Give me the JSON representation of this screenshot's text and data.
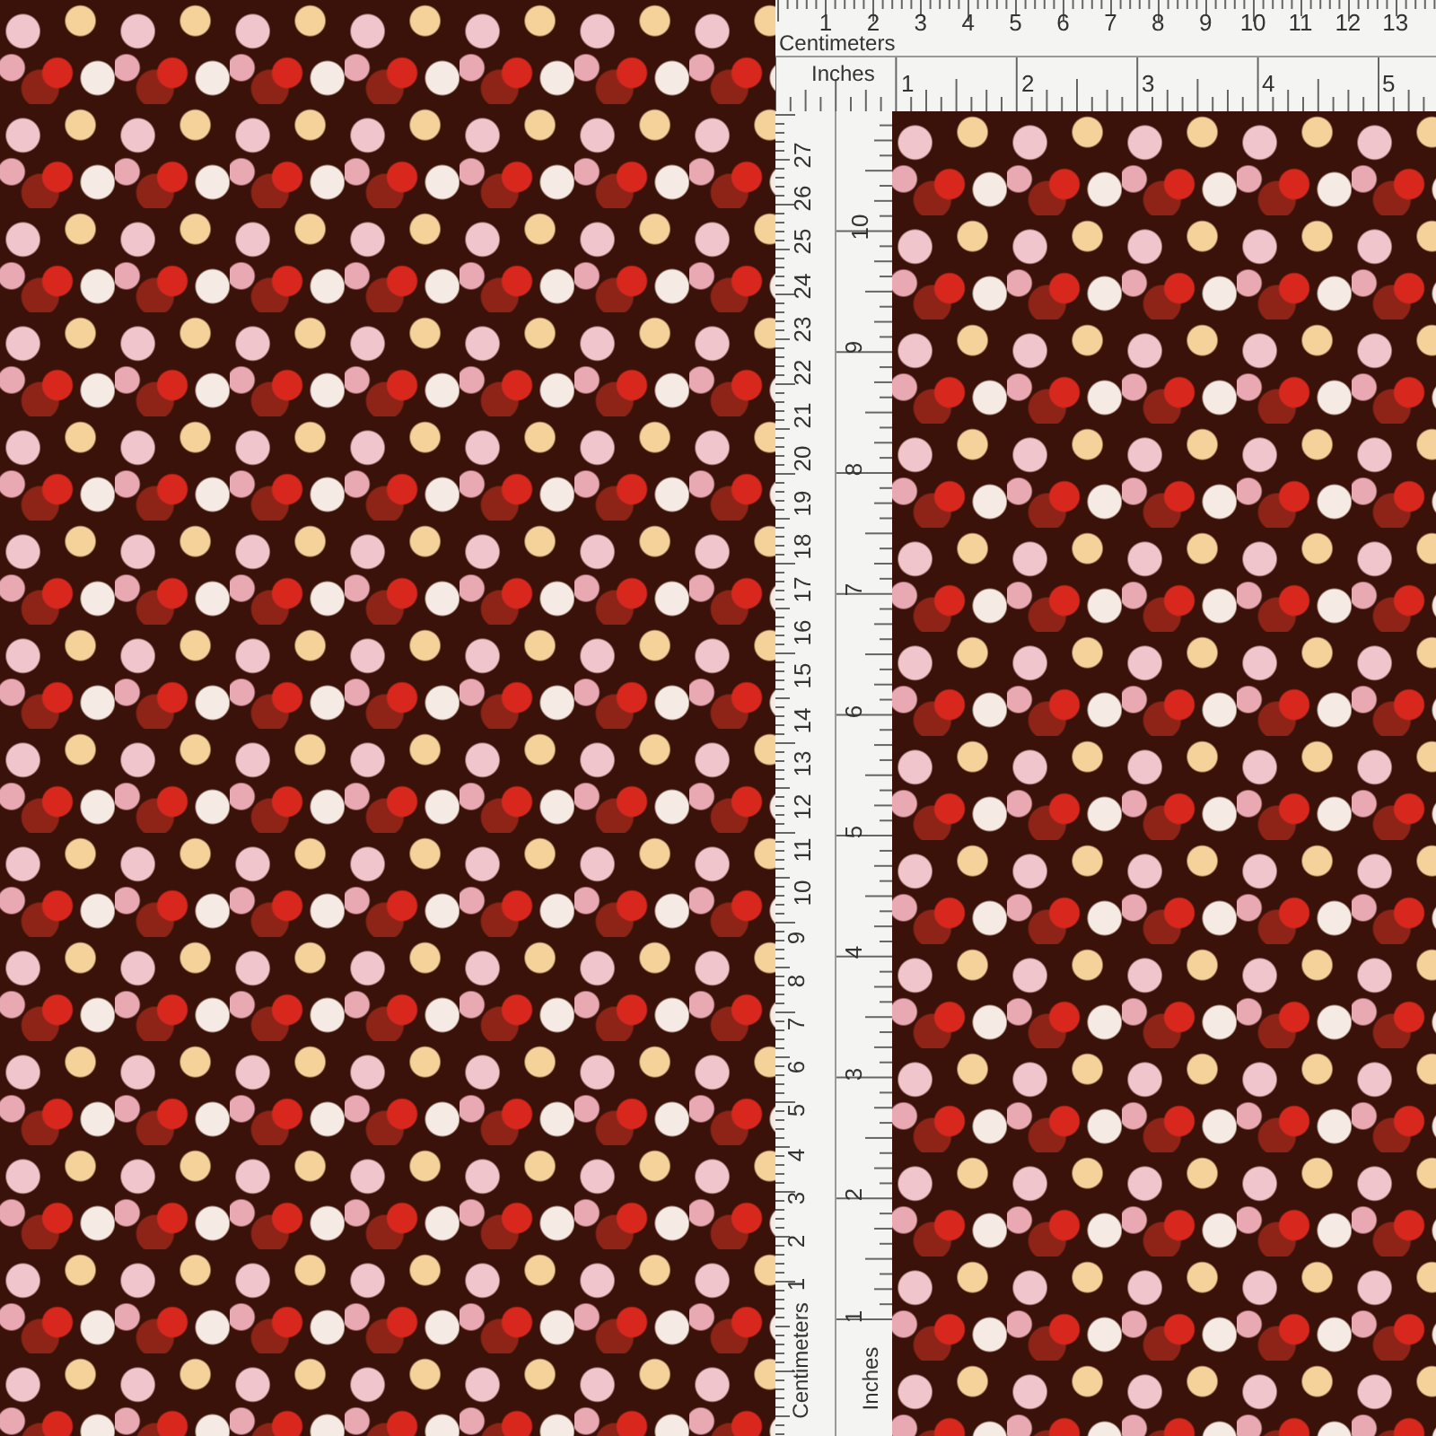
{
  "top_ruler": {
    "cm_label": "Centimeters",
    "inch_label": "Inches",
    "cm_numbers": [
      "1",
      "2",
      "3",
      "4",
      "5",
      "6",
      "7",
      "8",
      "9",
      "10",
      "11",
      "12",
      "13"
    ],
    "inch_numbers": [
      "1",
      "2",
      "3",
      "4",
      "5"
    ]
  },
  "side_ruler": {
    "cm_label": "Centimeters",
    "inch_label": "Inches",
    "cm_numbers": [
      "27",
      "26",
      "25",
      "24",
      "23",
      "22",
      "21",
      "20",
      "19",
      "18",
      "17",
      "16",
      "15",
      "14",
      "13",
      "12",
      "11",
      "10",
      "9",
      "8",
      "7",
      "6",
      "5",
      "4",
      "3",
      "2",
      "1"
    ],
    "inch_numbers": [
      "10",
      "9",
      "8",
      "7",
      "6",
      "5",
      "4",
      "3",
      "2",
      "1"
    ]
  }
}
